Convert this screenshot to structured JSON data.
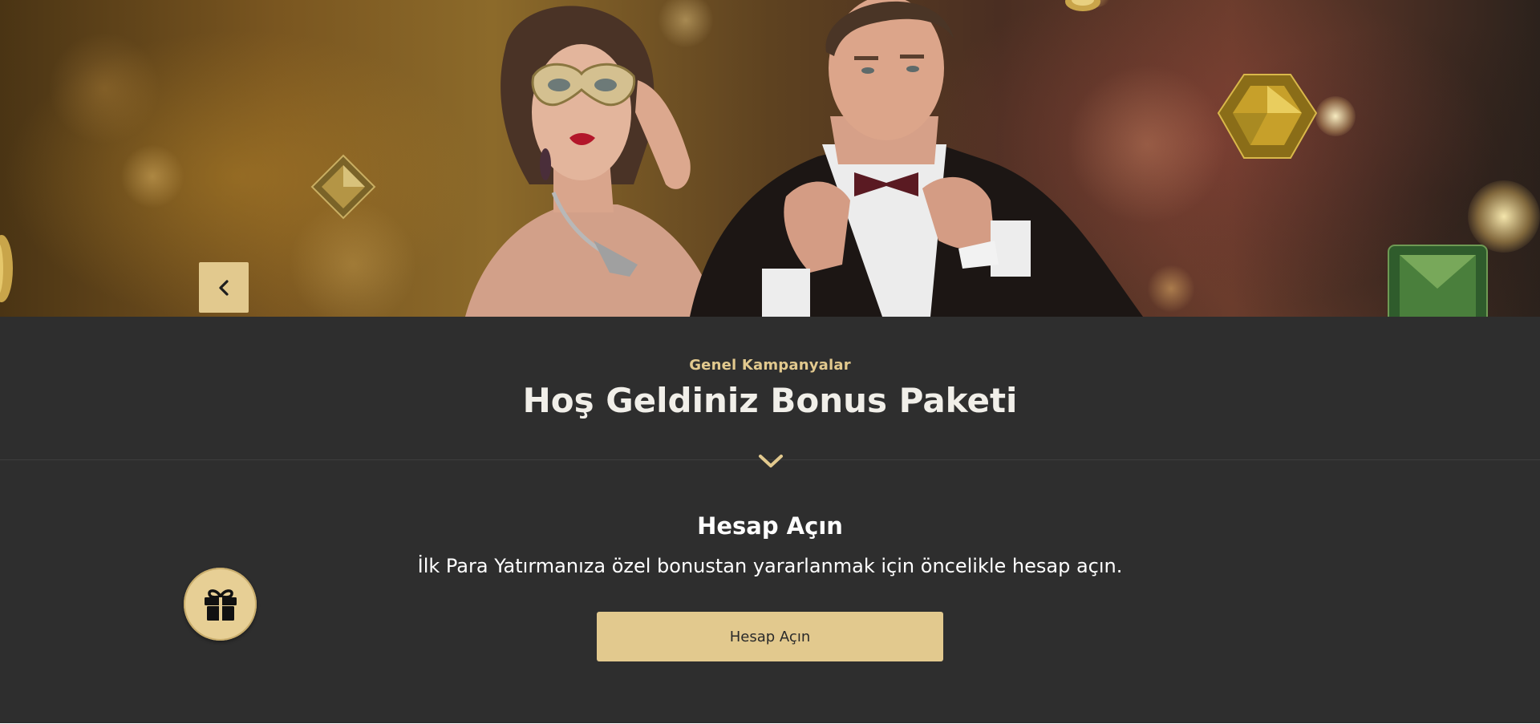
{
  "banner": {
    "prev_button_icon": "chevron-left-icon"
  },
  "promo": {
    "category": "Genel Kampanyalar",
    "title": "Hoş Geldiniz Bonus Paketi",
    "expand_icon": "chevron-down-icon"
  },
  "step": {
    "title": "Hesap Açın",
    "description": "İlk Para Yatırmanıza özel bonustan yararlanmak için öncelikle hesap açın.",
    "button_label": "Hesap Açın"
  },
  "floating": {
    "gift_icon": "gift-icon"
  },
  "colors": {
    "accent": "#e2c98e",
    "background_dark": "#2e2e2e",
    "title_text": "#f1efe9"
  }
}
